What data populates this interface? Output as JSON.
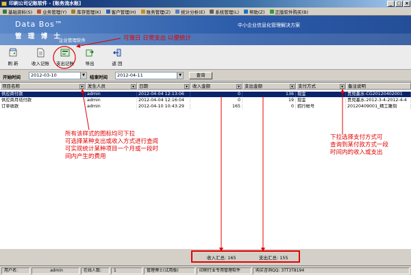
{
  "window": {
    "title": "印刷公司记账软件 - [账务流水账]"
  },
  "menu": [
    "基础资料(S)",
    "业务管理(Y)",
    "库存管理(K)",
    "客户管理(H)",
    "账务管理(Z)",
    "统计分析(E)",
    "系统管理(L)",
    "帮助(Z)",
    "正版软件购买(B)"
  ],
  "banner": {
    "brand_en": "Data Bos™",
    "brand_cn": "管 理 博 士",
    "subtitle": "企业管理软件",
    "slogan": "中小企业信息化管理解决方案"
  },
  "toolbar": {
    "refresh": "刷 新",
    "income": "收入记账",
    "expense": "支出记账",
    "export": "导出",
    "back": "返 回"
  },
  "search": {
    "start_label": "开始时间",
    "start_value": "2012-03-10",
    "end_label": "结束时间",
    "end_value": "2012-04-11",
    "query": "查询"
  },
  "columns": [
    "项目名称",
    "发生人员",
    "日期",
    "收入金额",
    "支出金额",
    "支付方式",
    "备注说明"
  ],
  "rows": [
    {
      "name": "供应商付款",
      "person": "admin",
      "date": "2012-04-04 12:13:06",
      "income": "0",
      "expense": "136",
      "method": "现金",
      "note": "贵兜墨水-CG20120402001"
    },
    {
      "name": "供应商月结付款",
      "person": "admin",
      "date": "2012-04-04 12:16:04",
      "income": "0",
      "expense": "19",
      "method": "现金",
      "note": "贵兜墨水-2012-3-4-2012-4-4"
    },
    {
      "name": "订单收款",
      "person": "admin",
      "date": "2012-04-10 10:43:29",
      "income": "165",
      "expense": "0",
      "method": "招行帐号",
      "note": "20120409001_精工雕刻"
    }
  ],
  "annotations": {
    "top": "可做日 日常支出 以便统计",
    "left": "所有该样式的图标均可下拉\n可选择某种支出或收入方式进行查阅\n可实现统计某种项目一个月或一段时\n间内产生的费用",
    "right": "下拉选择支付方式可\n查询到某付款方式一段\n时间内的收入或支出"
  },
  "summary": {
    "income": "收入汇总: 165",
    "expense": "支出汇总: 155"
  },
  "status": {
    "user_label": "用户名:",
    "user": "admin",
    "online_label": "在线人数:",
    "online": "1",
    "edition": "管理博士(试用版)",
    "product": "印刷行业专用管理软件",
    "contact": "购买咨询QQ: 3TT3T8194"
  },
  "colors": {
    "annotation": "#e00000",
    "selected_row": "#0a246a"
  }
}
